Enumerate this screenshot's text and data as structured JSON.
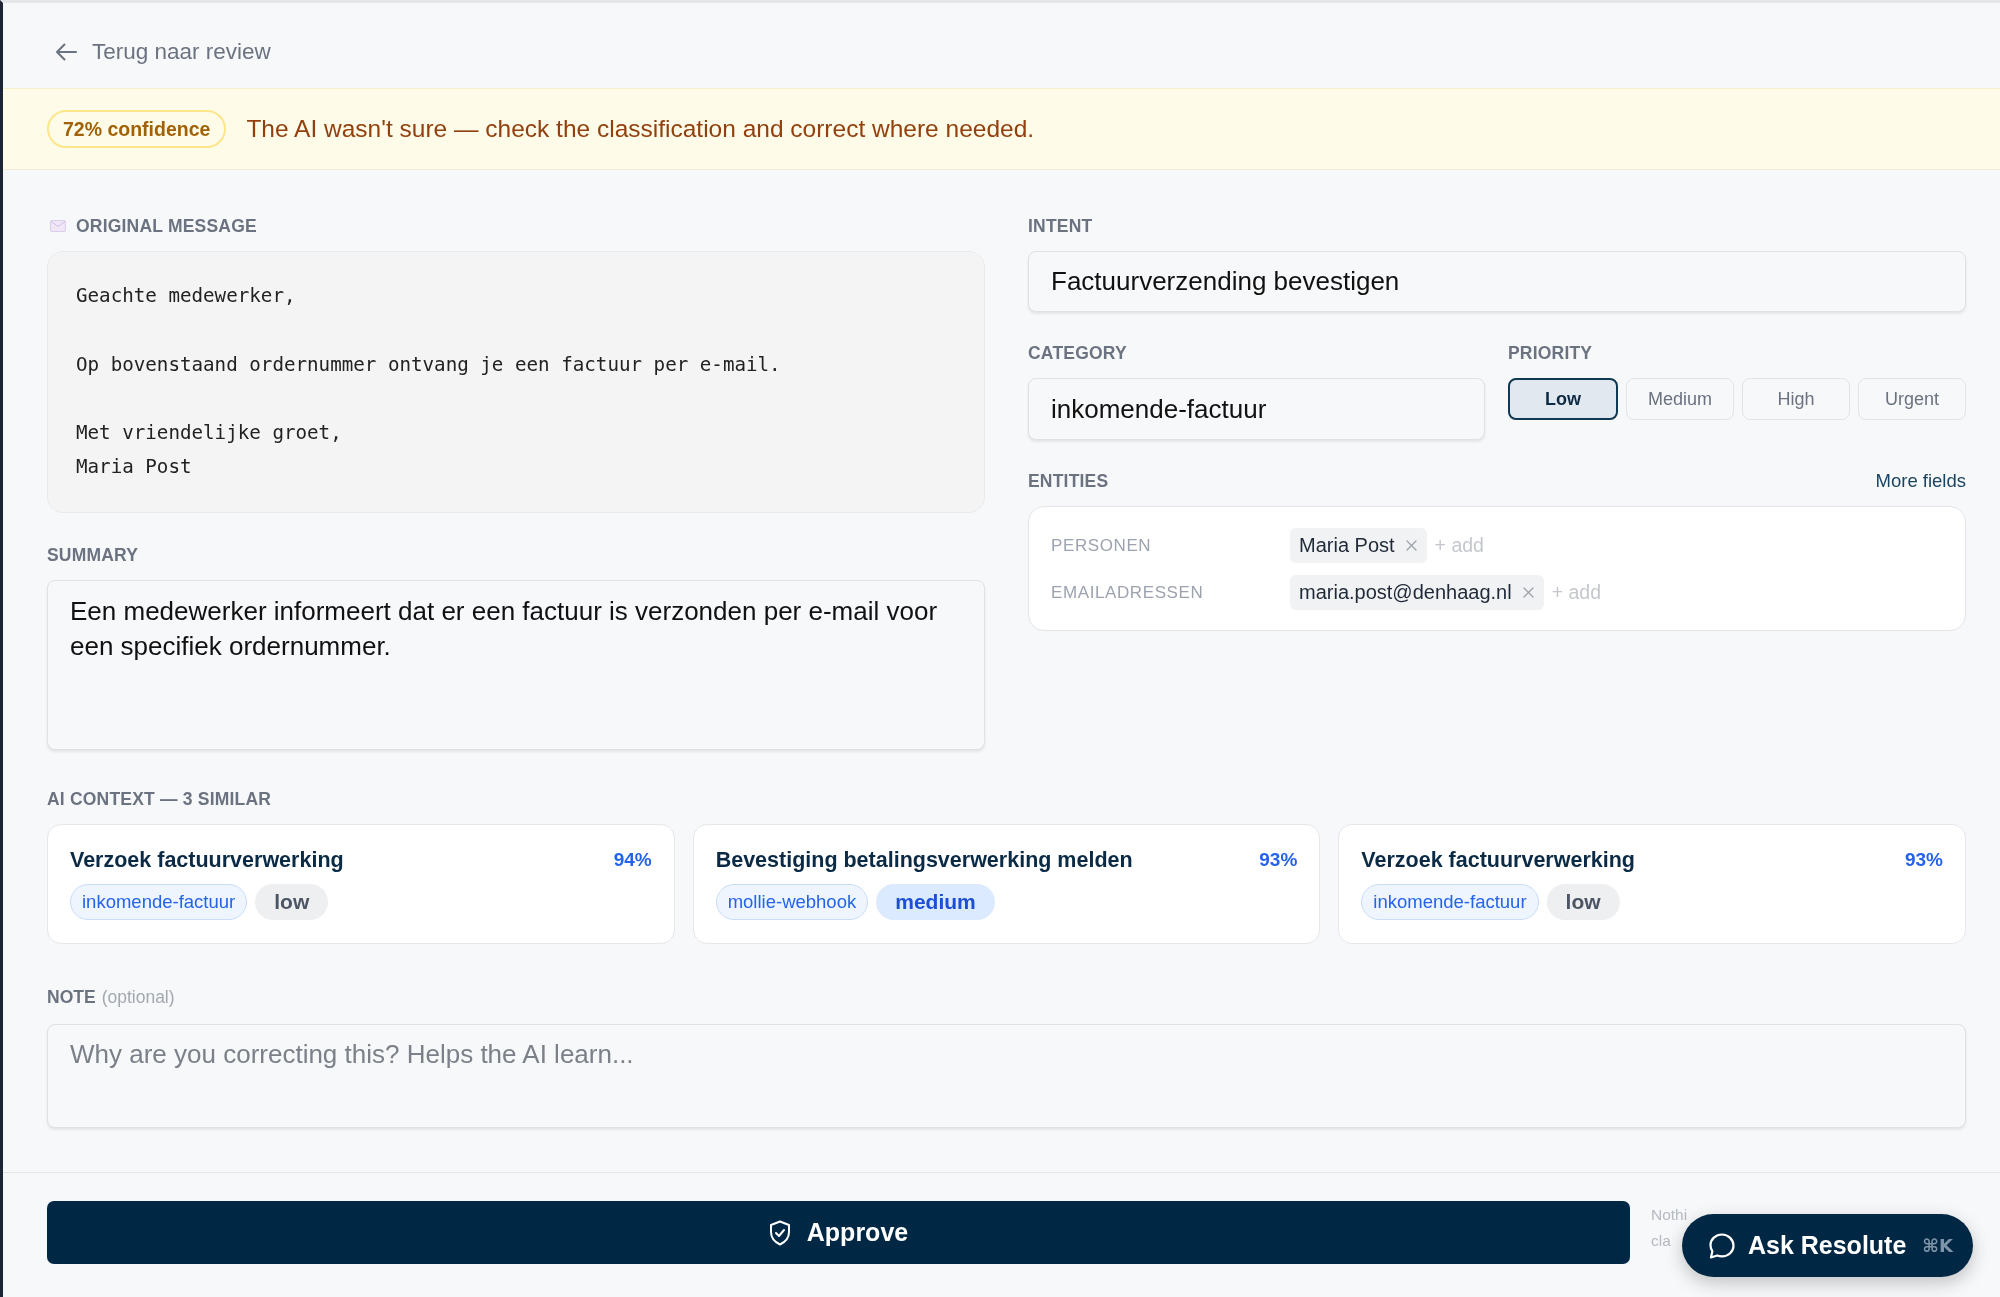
{
  "back_link": {
    "label": "Terug naar review"
  },
  "banner": {
    "confidence": "72% confidence",
    "message": "The AI wasn't sure — check the classification and correct where needed."
  },
  "original_message": {
    "label": "ORIGINAL MESSAGE",
    "body": "Geachte medewerker,\n\nOp bovenstaand ordernummer ontvang je een factuur per e-mail.\n\nMet vriendelijke groet,\nMaria Post"
  },
  "summary": {
    "label": "SUMMARY",
    "value": "Een medewerker informeert dat er een factuur is verzonden per e-mail voor een specifiek ordernummer."
  },
  "intent": {
    "label": "INTENT",
    "value": "Factuurverzending bevestigen"
  },
  "category": {
    "label": "CATEGORY",
    "value": "inkomende-factuur"
  },
  "priority": {
    "label": "PRIORITY",
    "options": [
      {
        "label": "Low",
        "selected": true
      },
      {
        "label": "Medium",
        "selected": false
      },
      {
        "label": "High",
        "selected": false
      },
      {
        "label": "Urgent",
        "selected": false
      }
    ]
  },
  "entities": {
    "label": "ENTITIES",
    "more_fields": "More fields",
    "groups": [
      {
        "label": "PERSONEN",
        "values": [
          "Maria Post"
        ],
        "add": "+ add"
      },
      {
        "label": "EMAILADRESSEN",
        "values": [
          "maria.post@denhaag.nl"
        ],
        "add": "+ add"
      }
    ]
  },
  "ai_context": {
    "label": "AI CONTEXT — 3 SIMILAR",
    "cards": [
      {
        "title": "Verzoek factuurverwerking",
        "score": "94%",
        "category": "inkomende-factuur",
        "priority": {
          "label": "low",
          "kind": "low"
        }
      },
      {
        "title": "Bevestiging betalingsverwerking melden",
        "score": "93%",
        "category": "mollie-webhook",
        "priority": {
          "label": "medium",
          "kind": "medium"
        }
      },
      {
        "title": "Verzoek factuurverwerking",
        "score": "93%",
        "category": "inkomende-factuur",
        "priority": {
          "label": "low",
          "kind": "low"
        }
      }
    ]
  },
  "note": {
    "label": "NOTE",
    "optional": "(optional)",
    "placeholder": "Why are you correcting this? Helps the AI learn..."
  },
  "approve_button": {
    "label": "Approve"
  },
  "footer_hint": {
    "lines": [
      "Nothi",
      "cla"
    ]
  },
  "assistant_button": {
    "label": "Ask Resolute",
    "shortcut": "⌘K"
  }
}
